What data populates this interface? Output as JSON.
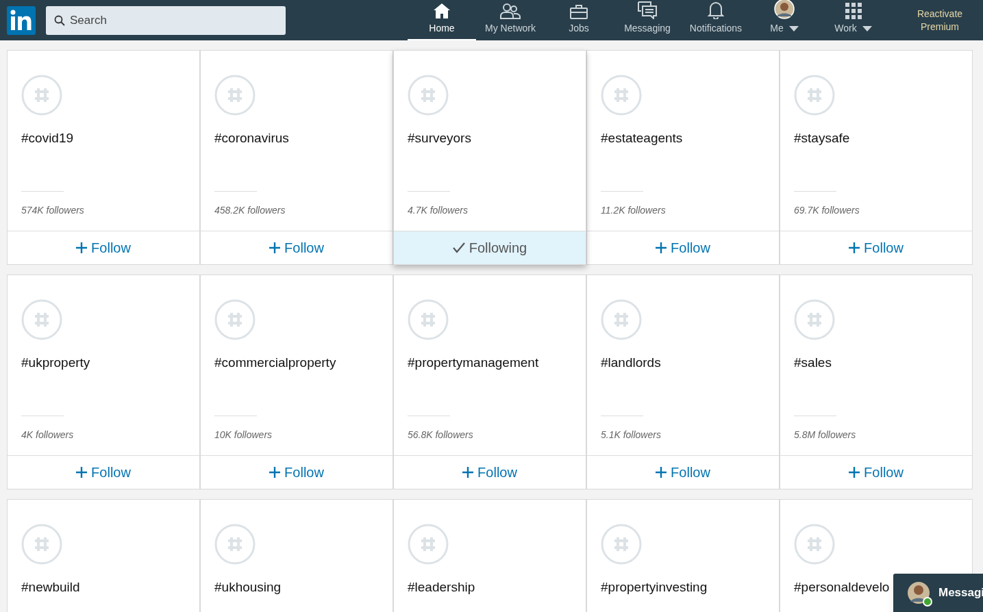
{
  "search": {
    "placeholder": "Search"
  },
  "nav": [
    {
      "label": "Home",
      "selected": true,
      "caret": false
    },
    {
      "label": "My Network",
      "selected": false,
      "caret": false
    },
    {
      "label": "Jobs",
      "selected": false,
      "caret": false
    },
    {
      "label": "Messaging",
      "selected": false,
      "caret": false
    },
    {
      "label": "Notifications",
      "selected": false,
      "caret": false
    },
    {
      "label": "Me",
      "selected": false,
      "caret": true
    },
    {
      "label": "Work",
      "selected": false,
      "caret": true
    }
  ],
  "premium_link": "Reactivate Premium",
  "hashtags": [
    {
      "name": "#covid19",
      "followers": "574K followers",
      "button": "Follow",
      "following": false
    },
    {
      "name": "#coronavirus",
      "followers": "458.2K followers",
      "button": "Follow",
      "following": false
    },
    {
      "name": "#surveyors",
      "followers": "4.7K followers",
      "button": "Following",
      "following": true
    },
    {
      "name": "#estateagents",
      "followers": "11.2K followers",
      "button": "Follow",
      "following": false
    },
    {
      "name": "#staysafe",
      "followers": "69.7K followers",
      "button": "Follow",
      "following": false
    },
    {
      "name": "#ukproperty",
      "followers": "4K followers",
      "button": "Follow",
      "following": false
    },
    {
      "name": "#commercialproperty",
      "followers": "10K followers",
      "button": "Follow",
      "following": false
    },
    {
      "name": "#propertymanagement",
      "followers": "56.8K followers",
      "button": "Follow",
      "following": false
    },
    {
      "name": "#landlords",
      "followers": "5.1K followers",
      "button": "Follow",
      "following": false
    },
    {
      "name": "#sales",
      "followers": "5.8M followers",
      "button": "Follow",
      "following": false
    },
    {
      "name": "#newbuild"
    },
    {
      "name": "#ukhousing"
    },
    {
      "name": "#leadership"
    },
    {
      "name": "#propertyinvesting"
    },
    {
      "name": "#personaldevelo"
    }
  ],
  "messaging_bar": {
    "label": "Messagi",
    "online": true
  }
}
